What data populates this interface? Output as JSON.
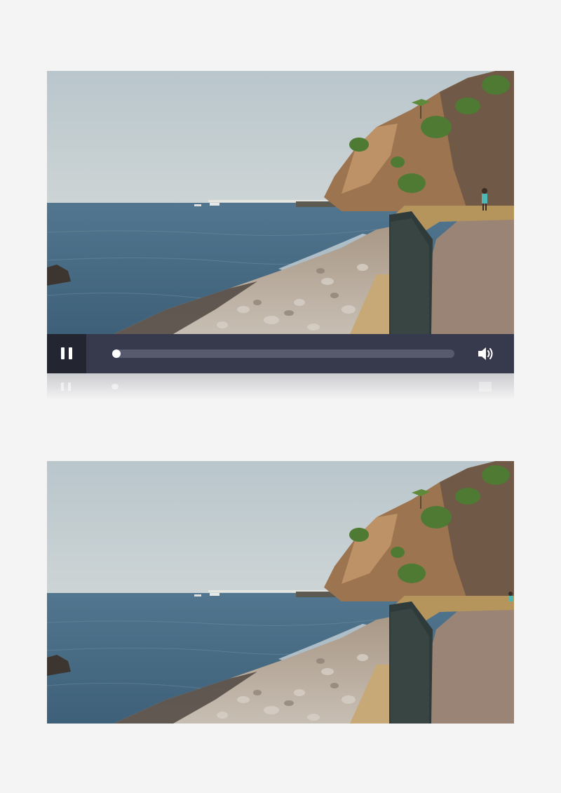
{
  "player": {
    "state": "playing",
    "progress": 0.0,
    "toggle_icon": "pause-icon",
    "volume_icon": "volume-icon"
  },
  "colors": {
    "control_bar": "#373a4c",
    "play_button_bg": "#232530",
    "track": "#575a6d",
    "thumb": "#ffffff",
    "page_bg": "#f4f4f4"
  }
}
